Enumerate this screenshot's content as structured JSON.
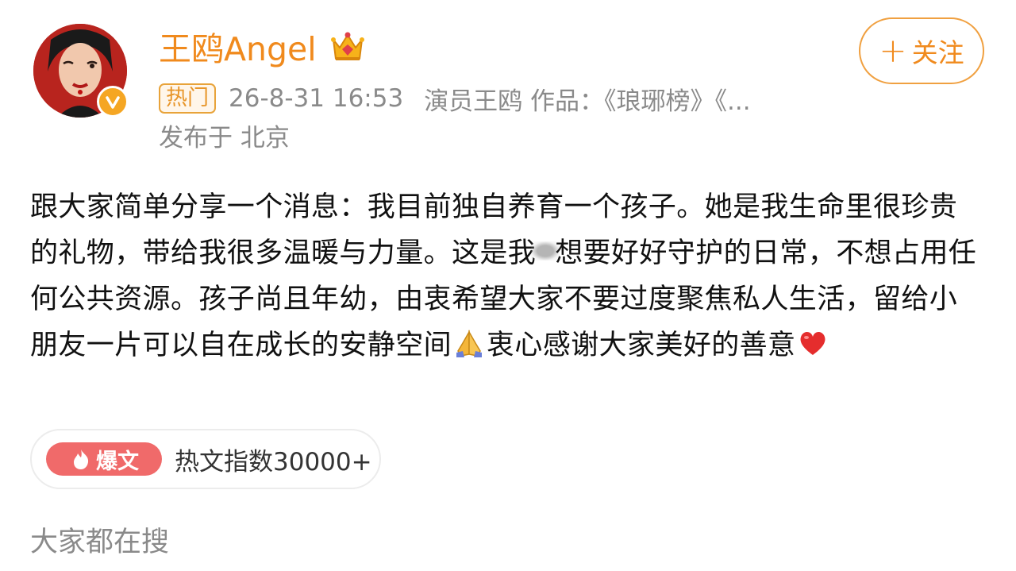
{
  "user": {
    "name": "王鸥Angel",
    "avatar_icon": "avatar-photo",
    "badge_icon": "verified-v-icon",
    "crown_icon": "crown-icon"
  },
  "follow_button": {
    "plus": "+",
    "label": "关注"
  },
  "meta": {
    "hot_tag": "热门",
    "time": "26-8-31 16:53",
    "bio": "演员王鸥 作品：《琅琊榜》《...",
    "location": "发布于 北京"
  },
  "post": {
    "text_part1": "跟大家简单分享一个消息：我目前独自养育一个孩子。她是我生命里很珍贵的礼物，带给我很多温暖与力量。这是我",
    "text_part2": "想要好好守护的日常，不想占用任何公共资源。孩子尚且年幼，由衷希望大家不要过度聚焦私人生活，留给小朋友一片可以自在成长的安静空间",
    "text_part3": "衷心感谢大家美好的善意",
    "emoji_pray": "folded-hands-emoji",
    "emoji_heart": "red-heart-emoji"
  },
  "hot_card": {
    "badge_label": "爆文",
    "index_text": "热文指数30000+"
  },
  "search_section": {
    "title": "大家都在搜"
  },
  "colors": {
    "accent_orange": "#f08a1d",
    "meta_gray": "#8a8a8a",
    "badge_red": "#f06a6a",
    "verified_gold": "#f5a623"
  }
}
